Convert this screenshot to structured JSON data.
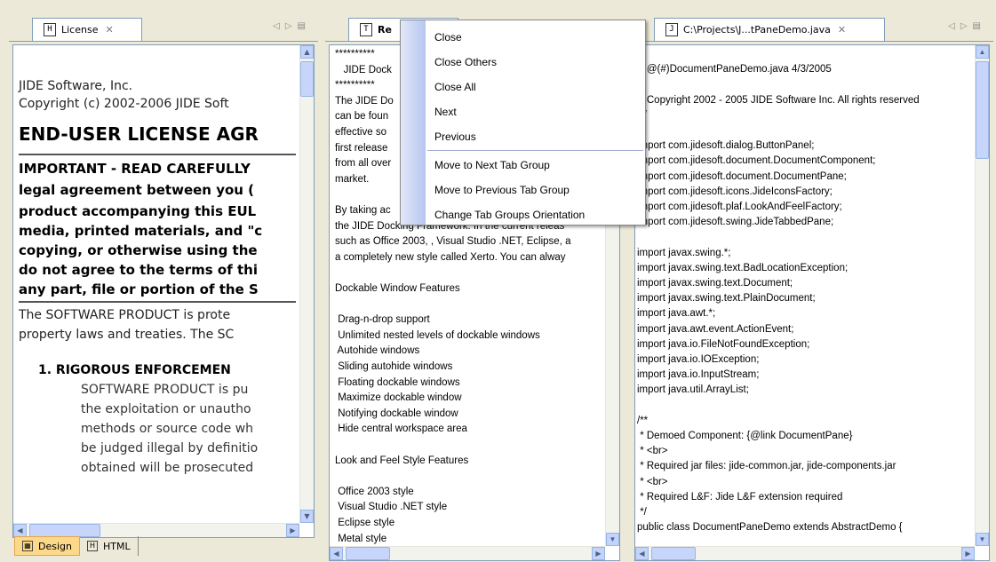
{
  "panes": [
    {
      "tab": {
        "label": "License",
        "icon": "H"
      },
      "lines": [
        {
          "text": "JIDE Software, Inc.",
          "style": "normal"
        },
        {
          "text": "Copyright (c) 2002-2006 JIDE Soft",
          "style": "normal"
        },
        {
          "text": "END-USER LICENSE AGR",
          "style": "heading"
        },
        {
          "text": "IMPORTANT - READ CAREFULLY",
          "style": "bold"
        },
        {
          "text": "legal agreement between you (",
          "style": "bold"
        },
        {
          "text": "product accompanying this EUL",
          "style": "bold"
        },
        {
          "text": "media, printed materials, and \"c",
          "style": "bold"
        },
        {
          "text": "copying, or otherwise using the",
          "style": "bold"
        },
        {
          "text": "do not agree to the terms of thi",
          "style": "bold"
        },
        {
          "text": "any part, file or portion of the S",
          "style": "bold"
        },
        {
          "text": "The SOFTWARE PRODUCT is prote",
          "style": "normal"
        },
        {
          "text": "property laws and treaties. The SC",
          "style": "normal"
        },
        {
          "text": "1. RIGOROUS ENFORCEMEN",
          "style": "listbold"
        },
        {
          "text": "SOFTWARE PRODUCT is pu",
          "style": "list"
        },
        {
          "text": "the exploitation or unautho",
          "style": "list"
        },
        {
          "text": "methods or source code wh",
          "style": "list"
        },
        {
          "text": "be judged illegal by definitio",
          "style": "list"
        },
        {
          "text": "obtained will be prosecuted",
          "style": "list"
        }
      ],
      "bottom_tabs": [
        {
          "label": "Design",
          "active": true
        },
        {
          "label": "HTML",
          "active": false
        }
      ]
    },
    {
      "tab": {
        "label": "Re",
        "icon": "T"
      },
      "lines": [
        "**********",
        "   JIDE Dock",
        "**********",
        "The JIDE Do",
        "can be foun",
        "effective so",
        "first release",
        "from all over",
        "market.",
        "",
        "By taking ac",
        "the JIDE Docking Framework. In the current releas",
        "such as Office 2003, , Visual Studio .NET, Eclipse, a",
        "a completely new style called Xerto. You can alway",
        "",
        "Dockable Window Features",
        "",
        " Drag-n-drop support",
        " Unlimited nested levels of dockable windows",
        " Autohide windows",
        " Sliding autohide windows",
        " Floating dockable windows",
        " Maximize dockable window",
        " Notifying dockable window",
        " Hide central workspace area",
        "",
        "Look and Feel Style Features",
        "",
        " Office 2003 style",
        " Visual Studio .NET style",
        " Eclipse style",
        " Metal style"
      ]
    },
    {
      "tab": {
        "label": "C:\\Projects\\J...tPaneDemo.java",
        "icon": "J"
      },
      "lines": [
        "*",
        " * @(#)DocumentPaneDemo.java 4/3/2005",
        " *",
        " * Copyright 2002 - 2005 JIDE Software Inc. All rights reserved",
        " */",
        "",
        "import com.jidesoft.dialog.ButtonPanel;",
        "import com.jidesoft.document.DocumentComponent;",
        "import com.jidesoft.document.DocumentPane;",
        "import com.jidesoft.icons.JideIconsFactory;",
        "import com.jidesoft.plaf.LookAndFeelFactory;",
        "import com.jidesoft.swing.JideTabbedPane;",
        "",
        "import javax.swing.*;",
        "import javax.swing.text.BadLocationException;",
        "import javax.swing.text.Document;",
        "import javax.swing.text.PlainDocument;",
        "import java.awt.*;",
        "import java.awt.event.ActionEvent;",
        "import java.io.FileNotFoundException;",
        "import java.io.IOException;",
        "import java.io.InputStream;",
        "import java.util.ArrayList;",
        "",
        "/**",
        " * Demoed Component: {@link DocumentPane}",
        " * <br>",
        " * Required jar files: jide-common.jar, jide-components.jar",
        " * <br>",
        " * Required L&F: Jide L&F extension required",
        " */",
        "public class DocumentPaneDemo extends AbstractDemo {"
      ]
    }
  ],
  "context_menu": {
    "items": [
      {
        "label": "Close",
        "group": 1
      },
      {
        "label": "Close Others",
        "group": 1
      },
      {
        "label": "Close All",
        "group": 1
      },
      {
        "label": "Next",
        "group": 1
      },
      {
        "label": "Previous",
        "group": 1
      },
      {
        "label": "Move to Next Tab Group",
        "group": 2
      },
      {
        "label": "Move to Previous Tab Group",
        "group": 2
      },
      {
        "label": "Change Tab Groups Orientation",
        "group": 2
      }
    ]
  },
  "icons": {
    "close": "close-icon",
    "scroll_left": "arrow-left-icon",
    "scroll_right": "arrow-right-icon",
    "list": "list-icon"
  },
  "colors": {
    "background": "#ece9d8",
    "active_bottom_tab": "#fcd989",
    "scrollbar": "#c7d5fb",
    "menu_strip": "#b6c6ef"
  }
}
